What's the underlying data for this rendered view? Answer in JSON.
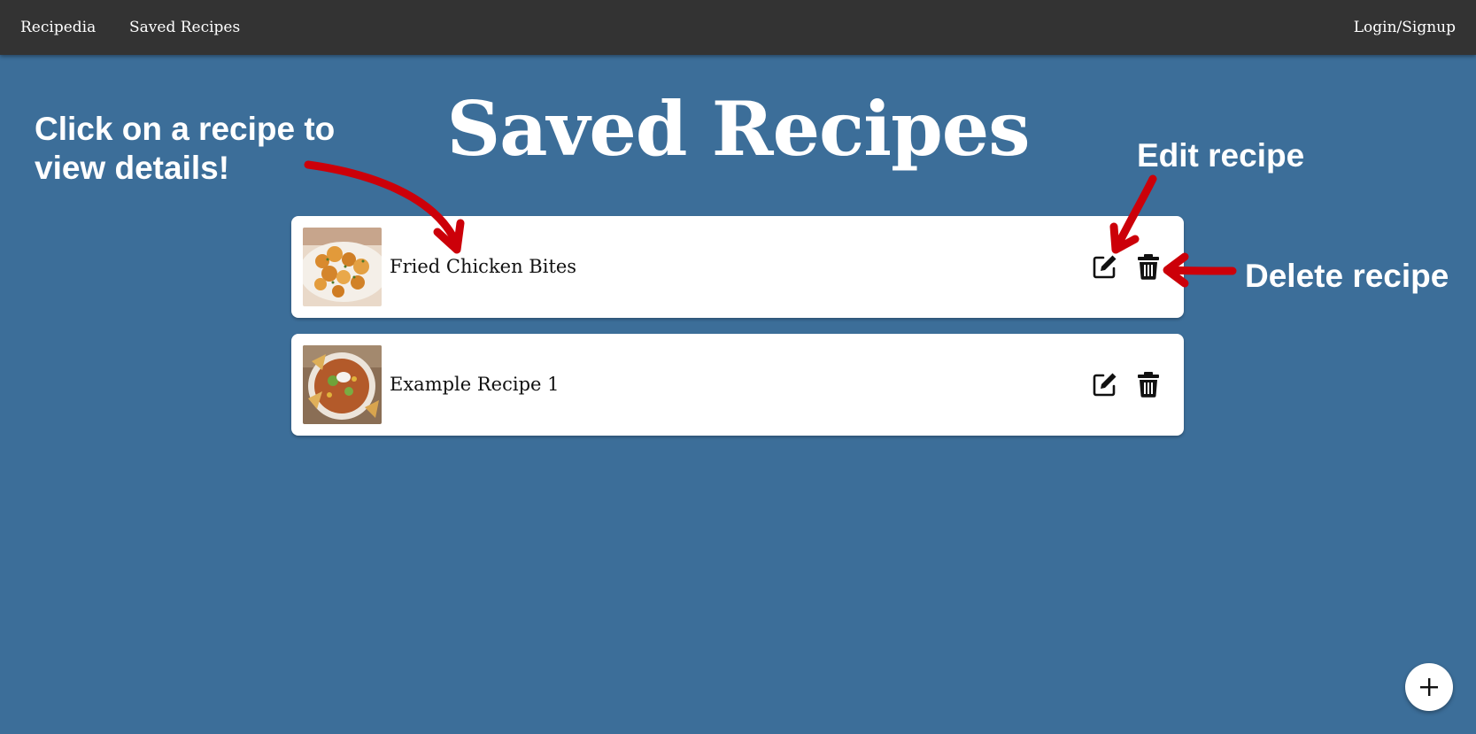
{
  "nav": {
    "brand": "Recipedia",
    "saved_recipes": "Saved Recipes",
    "login": "Login/Signup"
  },
  "page": {
    "title": "Saved Recipes"
  },
  "annotations": {
    "click_hint": "Click on a recipe to view details!",
    "edit_hint": "Edit recipe",
    "delete_hint": "Delete recipe"
  },
  "recipes": [
    {
      "name": "Fried Chicken Bites",
      "thumbnail": "fried-chicken-bites-photo"
    },
    {
      "name": "Example Recipe 1",
      "thumbnail": "soup-bowl-photo"
    }
  ],
  "icons": {
    "edit": "edit-icon",
    "delete": "trash-icon",
    "add": "plus-icon"
  },
  "colors": {
    "background": "#3c6e99",
    "navbar": "#333333",
    "card": "#ffffff",
    "annotation_arrow": "#d0000b",
    "text_light": "#ffffff"
  }
}
